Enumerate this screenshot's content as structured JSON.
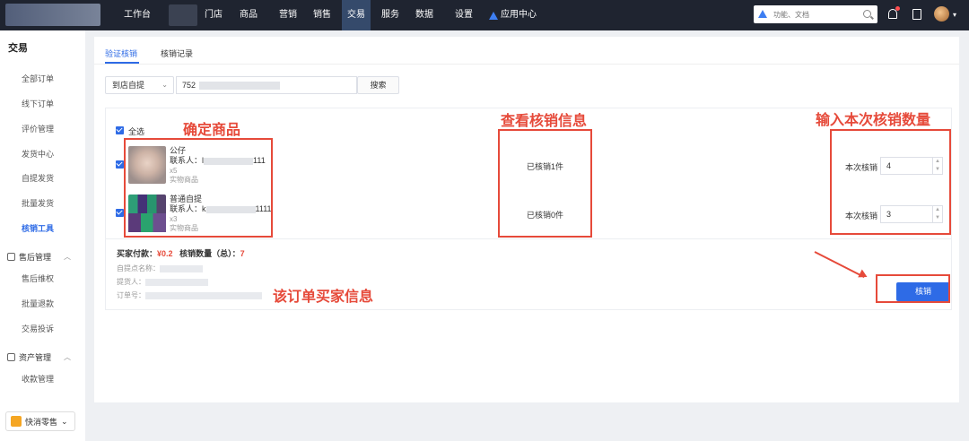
{
  "topnav": {
    "items": [
      "工作台",
      "门店",
      "商品",
      "营销",
      "销售",
      "交易",
      "服务",
      "数据",
      "设置",
      "应用中心"
    ],
    "active": "交易",
    "search_placeholder": "功能、文档"
  },
  "sidebar": {
    "title": "交易",
    "items": [
      "全部订单",
      "线下订单",
      "评价管理",
      "发货中心",
      "自提发货",
      "批量发货",
      "核销工具"
    ],
    "active_item": "核销工具",
    "group1": {
      "label": "售后管理",
      "items": [
        "售后维权",
        "批量退款",
        "交易投诉"
      ]
    },
    "group2": {
      "label": "资产管理",
      "items": [
        "收款管理"
      ]
    },
    "footer": "快消零售"
  },
  "main": {
    "tabs": [
      "验证核销",
      "核销记录"
    ],
    "active_tab": "验证核销",
    "select_value": "到店自提",
    "code_value_prefix": "752",
    "search_label": "搜索",
    "select_all": "全选",
    "products": [
      {
        "name": "公仔",
        "contact_label": "联系人：",
        "contact_prefix": "l",
        "contact_suffix": "111",
        "qty": "x5",
        "type": "实物商品",
        "verified": "已核销1件",
        "count_label": "本次核销",
        "count_value": "4"
      },
      {
        "name": "普通自提",
        "contact_label": "联系人：",
        "contact_prefix": "k",
        "contact_suffix": "1111",
        "qty": "x3",
        "type": "实物商品",
        "verified": "已核销0件",
        "count_label": "本次核销",
        "count_value": "3"
      }
    ],
    "summary": {
      "paid_label": "买家付款：",
      "paid_value": "¥0.2",
      "count_label": "核销数量（总）：",
      "count_value": "7"
    },
    "info": {
      "pickup_point_label": "自提点名称：",
      "picker_label": "提货人：",
      "order_no_label": "订单号："
    },
    "verify_button": "核销"
  },
  "annotations": {
    "confirm_product": "确定商品",
    "view_verify_info": "查看核销信息",
    "input_count": "输入本次核销数量",
    "buyer_info": "该订单买家信息"
  },
  "colors": {
    "nav_bg": "#1f2430",
    "accent": "#2e6be6",
    "annotation": "#e64a3a"
  }
}
